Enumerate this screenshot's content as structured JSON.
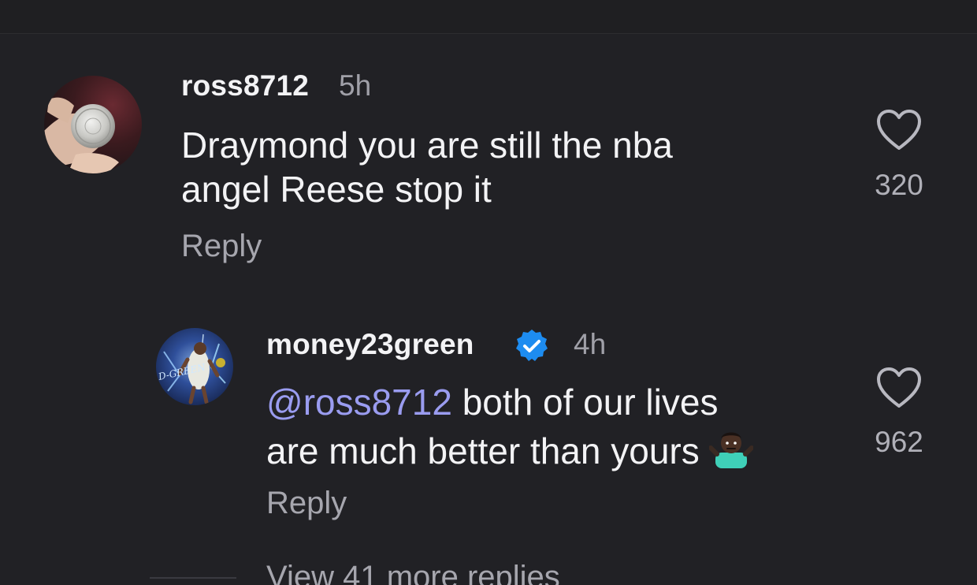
{
  "thread": {
    "comments": [
      {
        "username": "ross8712",
        "time": "5h",
        "text_line1": "Draymond you are still the nba",
        "text_line2": "angel Reese stop it",
        "reply_label": "Reply",
        "likes": "320",
        "avatar_icon": "coin-avatar"
      }
    ],
    "reply": {
      "username": "money23green",
      "verified": true,
      "time": "4h",
      "mention": "@ross8712",
      "text_line1_rest": " both of our lives",
      "text_line2": "are much better than yours",
      "emoji_icon": "person-shrugging-emoji",
      "reply_label": "Reply",
      "likes": "962",
      "avatar_icon": "player-avatar"
    },
    "view_more": "View 41 more replies"
  },
  "colors": {
    "background": "#212125",
    "text": "#f3f3f5",
    "muted": "#a6a6ae",
    "mention": "#9a9cf0",
    "verified": "#1d8cf0"
  }
}
